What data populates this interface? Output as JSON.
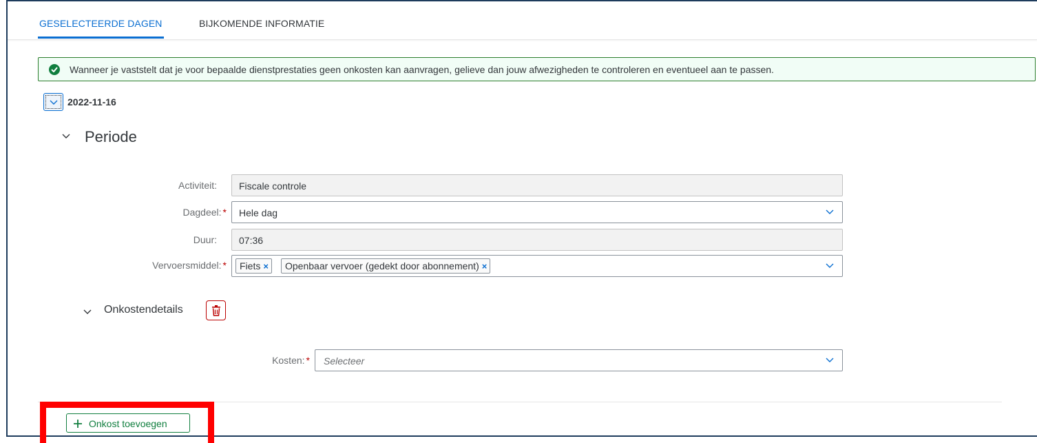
{
  "tabs": [
    {
      "label": "GESELECTEERDE DAGEN",
      "active": true
    },
    {
      "label": "BIJKOMENDE INFORMATIE",
      "active": false
    }
  ],
  "message_strip": {
    "icon": "success-check-icon",
    "text": "Wanneer je vaststelt dat je voor bepaalde dienstprestaties geen onkosten kan aanvragen, gelieve dan jouw afwezigheden te controleren en eventueel aan te passen."
  },
  "day": {
    "date": "2022-11-16"
  },
  "periode": {
    "title": "Periode",
    "fields": {
      "activiteit": {
        "label": "Activiteit:",
        "value": "Fiscale controle"
      },
      "dagdeel": {
        "label": "Dagdeel:",
        "required_mark": "*",
        "value": "Hele dag"
      },
      "duur": {
        "label": "Duur:",
        "value": "07:36"
      },
      "vervoersmiddel": {
        "label": "Vervoersmiddel:",
        "required_mark": "*",
        "tokens": [
          "Fiets",
          "Openbaar vervoer (gedekt door abonnement)"
        ],
        "remove_glyph": "×"
      }
    }
  },
  "onkostendetails": {
    "title": "Onkostendetails",
    "kosten": {
      "label": "Kosten:",
      "required_mark": "*",
      "placeholder": "Selecteer"
    }
  },
  "add_button": {
    "label": "Onkost toevoegen"
  },
  "colors": {
    "accent": "#0a6ed1",
    "success": "#107e3e",
    "negative": "#bb0000",
    "highlight": "#ff0000"
  }
}
